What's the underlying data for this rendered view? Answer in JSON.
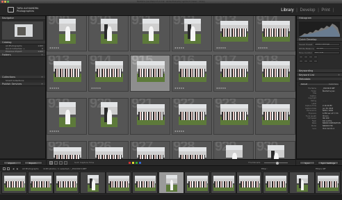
{
  "window": {
    "title": "Bienfait & Joao Plaza 4.5-2.lrcat - Adobe Photoshop Lightroom Classic - Library"
  },
  "identity_plate": {
    "line1": "TARA ALEXANDRA",
    "line2": "Photographies"
  },
  "modules": [
    {
      "label": "Library",
      "active": true
    },
    {
      "label": "Develop",
      "active": false
    },
    {
      "label": "Print",
      "active": false
    }
  ],
  "left_panel": {
    "navigator": {
      "title": "Navigator",
      "zoom": "FIT  FILL  1:1  3:1"
    },
    "catalog": {
      "title": "Catalog",
      "items": [
        {
          "label": "All Photographs",
          "count": "1183"
        },
        {
          "label": "Quick Collection +",
          "count": "0"
        },
        {
          "label": "Previous Import",
          "count": "1183"
        }
      ]
    },
    "folders": {
      "title": "Folders"
    },
    "collections": {
      "title": "Collections",
      "items": [
        {
          "label": "Smart Collections",
          "count": ""
        }
      ]
    },
    "publish_services": {
      "title": "Publish Services"
    }
  },
  "right_panel": {
    "histogram": {
      "title": "Histogram"
    },
    "quick_develop": {
      "title": "Quick Develop",
      "rows": [
        {
          "label": "Saved Preset",
          "value": "Default Settings"
        },
        {
          "label": "White Balance",
          "value": "As Shot"
        },
        {
          "label": "Tone Control",
          "value": "Auto Tone"
        }
      ]
    },
    "keywording": {
      "title": "Keywording"
    },
    "keyword_list": {
      "title": "Keyword List"
    },
    "metadata": {
      "title": "Metadata",
      "preset": "Default",
      "preset_side": "Customize",
      "rows": [
        {
          "k": "File Name",
          "v": "_DSC0915.NEF"
        },
        {
          "k": "Folder",
          "v": "Bienfait & Joao"
        },
        {
          "k": "Title",
          "v": ""
        },
        {
          "k": "Caption",
          "v": ""
        },
        {
          "k": "Copyright",
          "v": ""
        },
        {
          "k": "Rating",
          "v": "· · · · ·"
        },
        {
          "k": "Label",
          "v": ""
        },
        {
          "k": "Capture Time",
          "v": "2:14:06 PM"
        },
        {
          "k": "Capture Date",
          "v": "Jun 30, 2018"
        },
        {
          "k": "Dimensions",
          "v": "6000 x 4000"
        },
        {
          "k": "Exposure",
          "v": "1/250 sec at f / 5.6"
        },
        {
          "k": "Focal Length",
          "v": "35 mm"
        },
        {
          "k": "ISO Speed",
          "v": "ISO 200"
        },
        {
          "k": "Flash",
          "v": "Did not fire"
        },
        {
          "k": "Make",
          "v": "NIKON CORPORATION"
        },
        {
          "k": "Model",
          "v": "NIKON D750"
        },
        {
          "k": "Lens",
          "v": "35.0 mm f/1.4"
        }
      ]
    }
  },
  "grid": {
    "rows": [
      [
        {
          "num": "909",
          "orient": "p",
          "stars": "★★★★★",
          "sel": false
        },
        {
          "num": "910",
          "orient": "p",
          "stars": "",
          "sel": false
        },
        {
          "num": "911",
          "orient": "p",
          "stars": "",
          "sel": false
        },
        {
          "num": "912",
          "orient": "p",
          "stars": "★★★★★",
          "sel": false
        },
        {
          "num": "913",
          "orient": "l",
          "stars": "★★★★★",
          "sel": false
        },
        {
          "num": "914",
          "orient": "l",
          "stars": "★★★★★",
          "sel": false
        }
      ],
      [
        {
          "num": "913",
          "orient": "l",
          "stars": "★★★★★",
          "sel": false
        },
        {
          "num": "914",
          "orient": "l",
          "stars": "★★★★★",
          "sel": false
        },
        {
          "num": "915",
          "orient": "l",
          "stars": "",
          "sel": true
        },
        {
          "num": "916",
          "orient": "l",
          "stars": "★★★★★",
          "sel": false
        },
        {
          "num": "917",
          "orient": "l",
          "stars": "★★★★★",
          "sel": false
        },
        {
          "num": "918",
          "orient": "l",
          "stars": "",
          "sel": false
        }
      ],
      [
        {
          "num": "919",
          "orient": "p",
          "stars": "★★★★★",
          "sel": false
        },
        {
          "num": "920",
          "orient": "p",
          "stars": "",
          "sel": false
        },
        {
          "num": "921",
          "orient": "l",
          "stars": "",
          "sel": false
        },
        {
          "num": "922",
          "orient": "l",
          "stars": "★★★★★",
          "sel": false
        },
        {
          "num": "923",
          "orient": "l",
          "stars": "",
          "sel": false
        },
        {
          "num": "924",
          "orient": "l",
          "stars": "",
          "sel": false
        }
      ],
      [
        {
          "num": "925",
          "orient": "l",
          "stars": "",
          "sel": false
        },
        {
          "num": "926",
          "orient": "l",
          "stars": "",
          "sel": false
        },
        {
          "num": "927",
          "orient": "l",
          "stars": "",
          "sel": false
        },
        {
          "num": "928",
          "orient": "l",
          "stars": "",
          "sel": false
        },
        {
          "num": "929",
          "orient": "p",
          "stars": "",
          "sel": false
        },
        {
          "num": "930",
          "orient": "p",
          "stars": "",
          "sel": false
        }
      ]
    ]
  },
  "toolbar": {
    "sort_label": "Sort:",
    "sort_value": "Capture Time",
    "thumbnails_label": "Thumbnails"
  },
  "bottom_left": {
    "import_label": "Import...",
    "export_label": "Export..."
  },
  "bottom_right": {
    "sync_label": "Sync",
    "sync_settings_label": "Sync Settings"
  },
  "filmstrip_bar": {
    "source": "All Photographs",
    "info": "1183 photos / 1 selected / _DSC0915.NEF",
    "filter_label": "Filter :",
    "filter_value": "Filters Off"
  },
  "filmstrip": [
    {
      "orient": "l",
      "sel": false
    },
    {
      "orient": "l",
      "sel": false
    },
    {
      "orient": "l",
      "sel": false
    },
    {
      "orient": "p",
      "sel": false
    },
    {
      "orient": "l",
      "sel": false
    },
    {
      "orient": "l",
      "sel": false
    },
    {
      "orient": "p",
      "sel": true
    },
    {
      "orient": "l",
      "sel": false
    },
    {
      "orient": "l",
      "sel": false
    },
    {
      "orient": "l",
      "sel": false
    },
    {
      "orient": "l",
      "sel": false
    },
    {
      "orient": "p",
      "sel": false
    },
    {
      "orient": "l",
      "sel": false
    }
  ],
  "colors": {
    "accent": "#f0f0f0",
    "grid_bg": "#5c5c5c",
    "selected_cell": "#8e8e8e",
    "panel_bg": "#2b2b2b",
    "grass": "#5d7a3a"
  }
}
